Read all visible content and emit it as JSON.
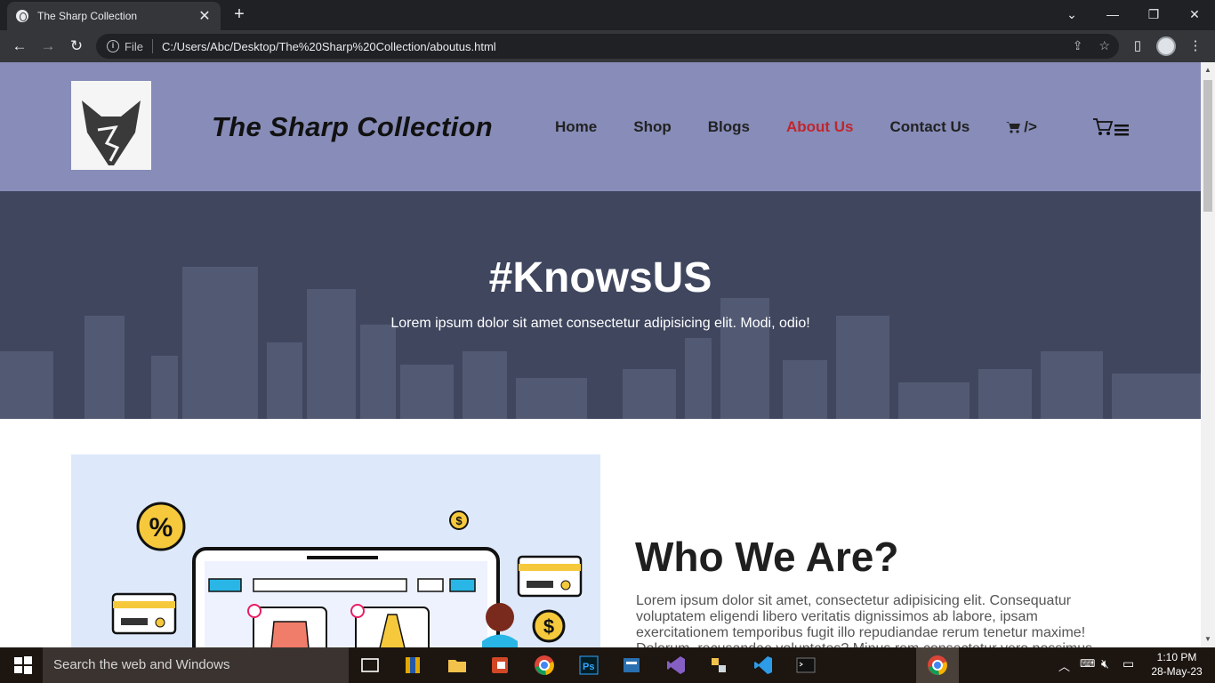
{
  "browser": {
    "tab_title": "The Sharp Collection",
    "tab_close": "✕",
    "new_tab": "+",
    "file_label": "File",
    "url": "C:/Users/Abc/Desktop/The%20Sharp%20Collection/aboutus.html"
  },
  "site": {
    "brand": "The Sharp Collection",
    "nav": [
      "Home",
      "Shop",
      "Blogs",
      "About Us",
      "Contact Us"
    ],
    "nav_active": "About Us",
    "nav_cart_text": "/>",
    "hero_title": "#KnowsUS",
    "hero_subtitle": "Lorem ipsum dolor sit amet consectetur adipisicing elit. Modi, odio!",
    "section_title": "Who We Are?",
    "section_text": "Lorem ipsum dolor sit amet, consectetur adipisicing elit. Consequatur voluptatem eligendi libero veritatis dignissimos ab labore, ipsam exercitationem temporibus fugit illo repudiandae rerum tenetur maxime! Dolorum, recusandae voluptates? Minus rem consectetur vero possimus illo."
  },
  "taskbar": {
    "search_placeholder": "Search the web and Windows",
    "time": "1:10 PM",
    "date": "28-May-23"
  },
  "colors": {
    "header_bg": "#878cb8",
    "hero_bg": "#3f465e",
    "active_nav": "#c0262d"
  }
}
